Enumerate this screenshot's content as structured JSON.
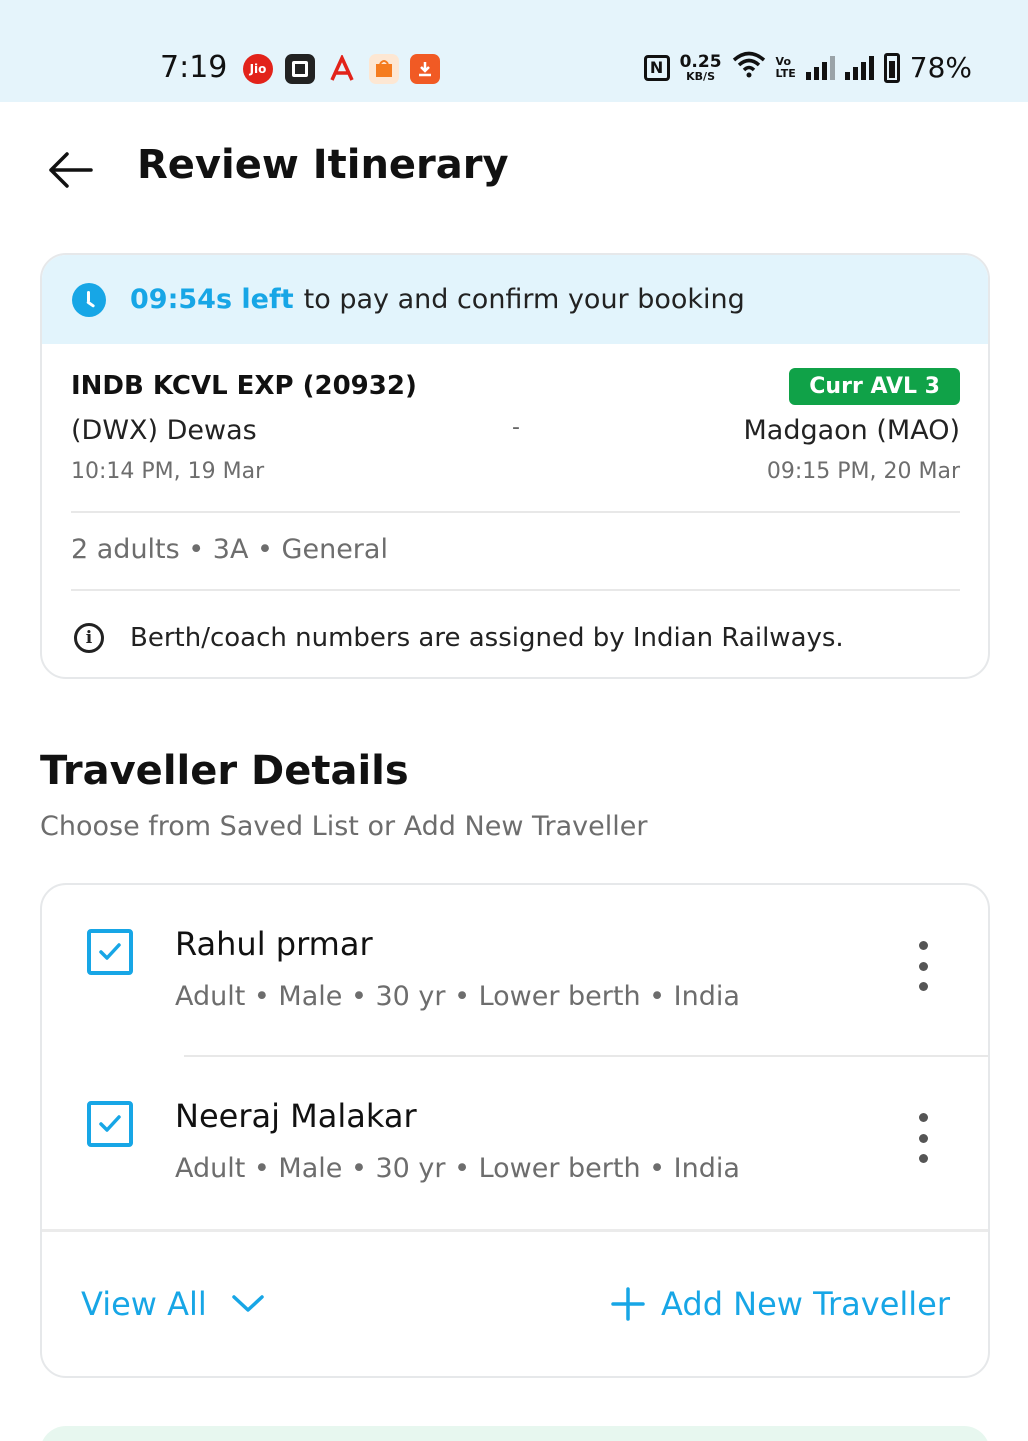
{
  "status_bar": {
    "time": "7:19",
    "apps": [
      {
        "name": "jio-icon",
        "label": "Jio",
        "color": "#e2231a"
      },
      {
        "name": "gallery-app-icon",
        "label": "",
        "color": "#222222"
      },
      {
        "name": "acrobat-app-icon",
        "label": "",
        "color": "#e2231a"
      },
      {
        "name": "shopping-app-icon",
        "label": "",
        "color": "#f57c1f"
      },
      {
        "name": "notification-app-icon",
        "label": "",
        "color": "#f15a24"
      }
    ],
    "net_speed_value": "0.25",
    "net_speed_unit": "KB/S",
    "volte_top": "Vo",
    "volte_bottom": "LTE",
    "battery": "78%"
  },
  "header": {
    "title": "Review Itinerary"
  },
  "itinerary": {
    "timer_left": "09:54s left",
    "timer_text": "to pay and confirm your booking",
    "train_name": "INDB KCVL EXP (20932)",
    "availability": "Curr AVL 3",
    "from_station": "(DWX) Dewas",
    "to_station": "Madgaon (MAO)",
    "separator": "-",
    "from_time": "10:14 PM, 19 Mar",
    "to_time": "09:15 PM, 20 Mar",
    "pax_summary": "2 adults • 3A • General",
    "info_note": "Berth/coach numbers are assigned by Indian Railways.",
    "colors": {
      "accent": "#17a6e6",
      "available": "#10a248"
    }
  },
  "travellers": {
    "title": "Traveller Details",
    "subtitle": "Choose from Saved List or Add New Traveller",
    "list": [
      {
        "name": "Rahul prmar",
        "meta": "Adult • Male • 30 yr • Lower berth • India",
        "checked": true
      },
      {
        "name": "Neeraj Malakar",
        "meta": "Adult • Male • 30 yr • Lower berth • India",
        "checked": true
      }
    ],
    "view_all_label": "View All",
    "add_new_label": "Add New Traveller"
  }
}
